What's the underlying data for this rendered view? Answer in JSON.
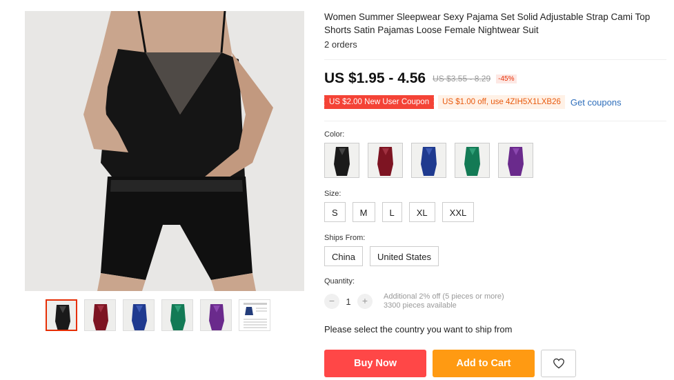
{
  "product": {
    "title": "Women Summer Sleepwear Sexy Pajama Set Solid Adjustable Strap Cami Top Shorts Satin Pajamas Loose Female Nightwear Suit",
    "orders": "2 orders",
    "price": "US $1.95 - 4.56",
    "original_price": "US $3.55 - 8.29",
    "discount": "-45%"
  },
  "coupons": {
    "new_user": "US $2.00 New User Coupon",
    "code_offer": "US $1.00 off, use 4ZIH5X1LXB26",
    "get_coupons": "Get coupons"
  },
  "color": {
    "label": "Color:",
    "options": [
      {
        "name": "black",
        "hex": "#1a1a1a"
      },
      {
        "name": "wine",
        "hex": "#7d1422"
      },
      {
        "name": "blue",
        "hex": "#1f3a8f"
      },
      {
        "name": "green",
        "hex": "#137a55"
      },
      {
        "name": "purple",
        "hex": "#6a2a8c"
      }
    ]
  },
  "size": {
    "label": "Size:",
    "options": [
      "S",
      "M",
      "L",
      "XL",
      "XXL"
    ]
  },
  "ships_from": {
    "label": "Ships From:",
    "options": [
      "China",
      "United States"
    ]
  },
  "quantity": {
    "label": "Quantity:",
    "minus": "−",
    "value": "1",
    "plus": "+",
    "info_line1": "Additional 2% off (5 pieces or more)",
    "info_line2": "3300 pieces available"
  },
  "ship_message": "Please select the country you want to ship from",
  "actions": {
    "buy_now": "Buy Now",
    "add_to_cart": "Add to Cart",
    "wishlist_icon": "heart-icon"
  },
  "thumbnails": [
    {
      "name": "black",
      "hex": "#1a1a1a"
    },
    {
      "name": "wine",
      "hex": "#7d1422"
    },
    {
      "name": "blue",
      "hex": "#1f3a8f"
    },
    {
      "name": "green",
      "hex": "#137a55"
    },
    {
      "name": "purple",
      "hex": "#6a2a8c"
    },
    {
      "name": "size-chart",
      "hex": "#ffffff"
    }
  ],
  "accent": {
    "primary": "#ff4747",
    "secondary": "#ff9a12",
    "link": "#2e6ebb"
  }
}
